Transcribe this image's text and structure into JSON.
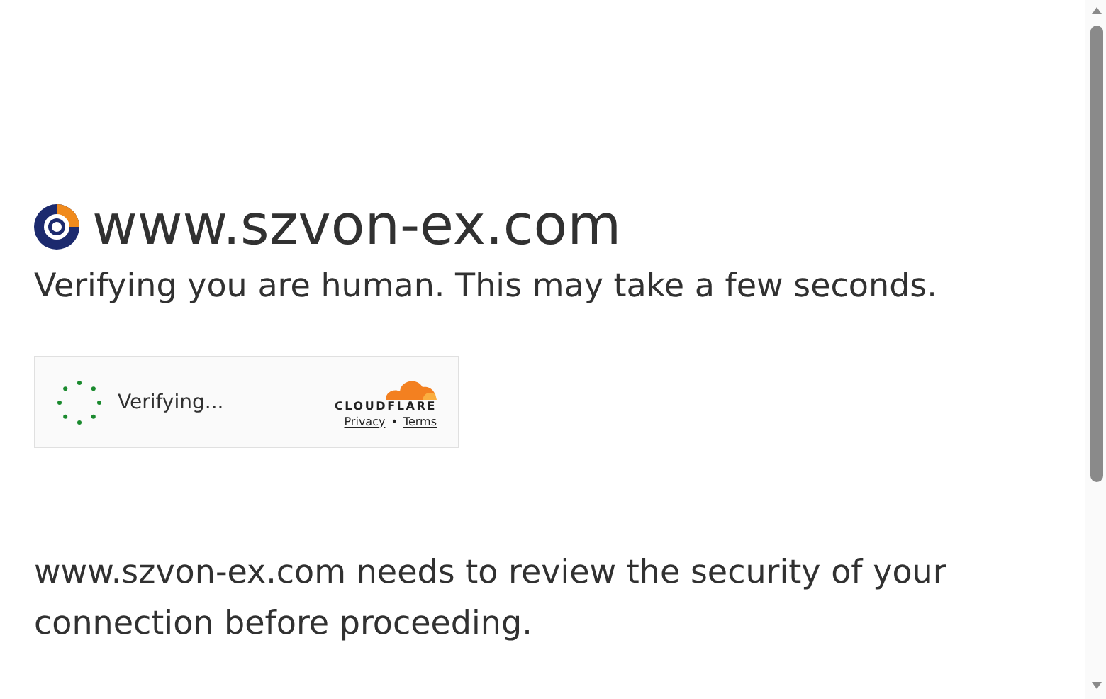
{
  "site": {
    "domain": "www.szvon-ex.com"
  },
  "subtitle": "Verifying you are human. This may take a few seconds.",
  "widget": {
    "status": "Verifying...",
    "brand": "CLOUDFLARE",
    "links": [
      {
        "label": "Privacy"
      },
      {
        "label": "Terms"
      }
    ],
    "separator": "•"
  },
  "message": "www.szvon-ex.com needs to review the security of your connection before proceeding."
}
